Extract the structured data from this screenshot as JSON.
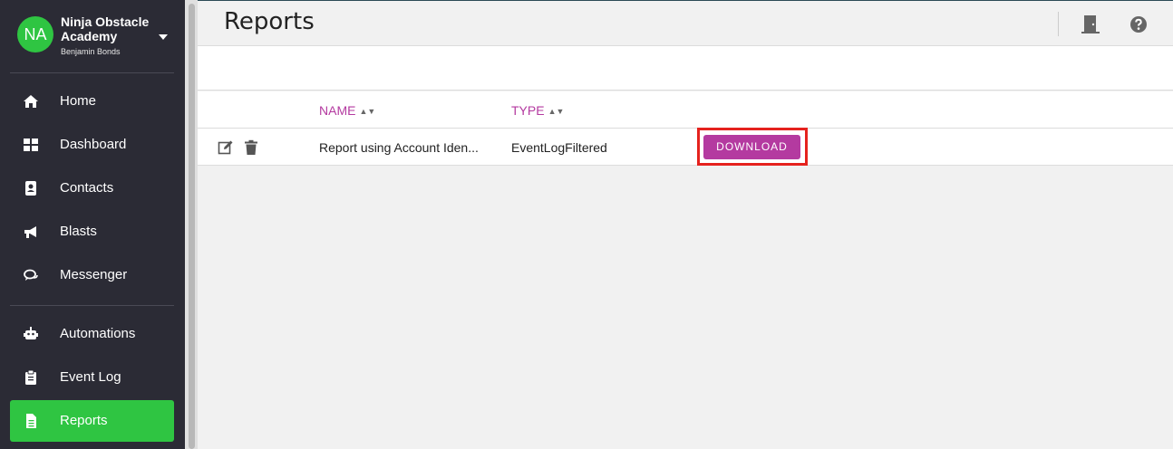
{
  "org": {
    "initials": "NA",
    "name": "Ninja Obstacle Academy",
    "user": "Benjamin Bonds"
  },
  "sidebar": {
    "items": [
      {
        "label": "Home",
        "icon": "home-icon"
      },
      {
        "label": "Dashboard",
        "icon": "dashboard-icon"
      },
      {
        "label": "Contacts",
        "icon": "contacts-icon"
      },
      {
        "label": "Blasts",
        "icon": "megaphone-icon"
      },
      {
        "label": "Messenger",
        "icon": "chat-icon"
      },
      {
        "label": "Automations",
        "icon": "robot-icon"
      },
      {
        "label": "Event Log",
        "icon": "clipboard-icon"
      },
      {
        "label": "Reports",
        "icon": "report-icon",
        "active": true
      }
    ]
  },
  "header": {
    "title": "Reports",
    "icons": [
      "exit-door-icon",
      "help-icon"
    ]
  },
  "table": {
    "columns": [
      "NAME",
      "TYPE"
    ],
    "rows": [
      {
        "name": "Report using Account Iden...",
        "type": "EventLogFiltered",
        "action": "DOWNLOAD"
      }
    ]
  },
  "colors": {
    "accent": "#b43aa0",
    "active": "#2fc542",
    "sidebar_bg": "#2b2b35",
    "highlight": "#e5221e"
  }
}
